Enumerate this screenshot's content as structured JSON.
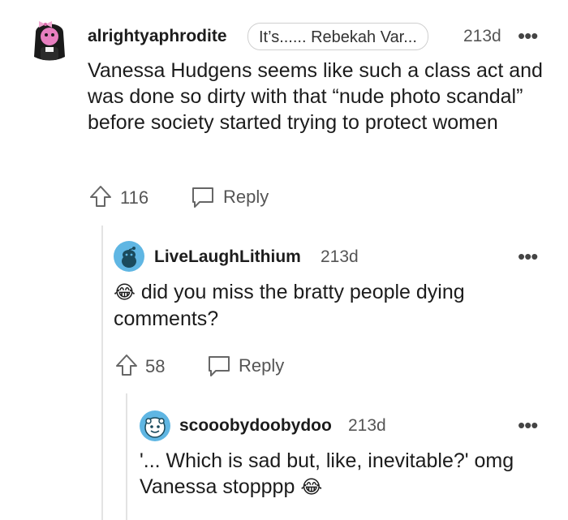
{
  "comments": [
    {
      "username": "alrightyaphrodite",
      "flair": "It’s...... Rebekah Var...",
      "age": "213d",
      "more": "•••",
      "body": "Vanessa Hudgens seems like such a class act and was done so dirty with that “nude photo scandal” before society started trying to protect women",
      "votes": "116",
      "reply_label": "Reply",
      "avatar": "user-avatar-icon"
    },
    {
      "username": "LiveLaughLithium",
      "age": "213d",
      "more": "•••",
      "emoji": "😂",
      "body": "did you miss the bratty people dying comments?",
      "votes": "58",
      "reply_label": "Reply",
      "avatar": "snoo-avatar-icon"
    },
    {
      "username": "scooobydoobydoo",
      "age": "213d",
      "more": "•••",
      "body": "'... Which is sad but, like, inevitable?' omg Vanessa stopppp",
      "emoji": "😂",
      "avatar": "snoo-avatar-icon"
    }
  ],
  "colors": {
    "thread_line": "#e3e3e3",
    "text_primary": "#1c1c1c",
    "text_muted": "#555555",
    "snoo_blue": "#5fb6e3"
  }
}
